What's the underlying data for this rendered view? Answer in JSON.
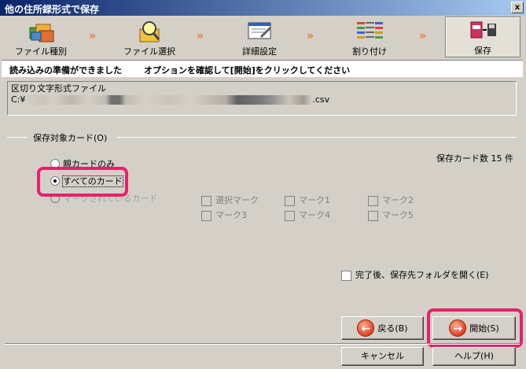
{
  "window": {
    "title": "他の住所録形式で保存",
    "close": "x"
  },
  "steps": [
    {
      "label": "ファイル種別",
      "icon": "folders-icon"
    },
    {
      "label": "ファイル選択",
      "icon": "magnifier-folder-icon"
    },
    {
      "label": "詳細設定",
      "icon": "settings-window-icon"
    },
    {
      "label": "割り付け",
      "icon": "mapping-arrows-icon"
    },
    {
      "label": "保存",
      "icon": "save-disk-icon"
    }
  ],
  "arrow": "»",
  "info": {
    "msg1": "読み込みの準備ができました",
    "msg2": "オプションを確認して[開始]をクリックしてください"
  },
  "file": {
    "type_label": "区切り文字形式ファイル",
    "path_prefix": "C:¥",
    "path_suffix": ".csv"
  },
  "target": {
    "group_label": "保存対象カード(O)",
    "count_text": "保存カード数 15 件",
    "radio_parent": "親カードのみ",
    "radio_all": "すべてのカード",
    "radio_marked": "マークされているカード"
  },
  "marks": [
    "選択マーク",
    "マーク1",
    "マーク2",
    "マーク3",
    "マーク4",
    "マーク5"
  ],
  "open_folder": "完了後、保存先フォルダを開く(E)",
  "buttons": {
    "back": "戻る(B)",
    "start": "開始(S)",
    "cancel": "キャンセル",
    "help": "ヘルプ(H)"
  },
  "colors": {
    "highlight": "#e8206a",
    "arrow": "#f07830"
  }
}
